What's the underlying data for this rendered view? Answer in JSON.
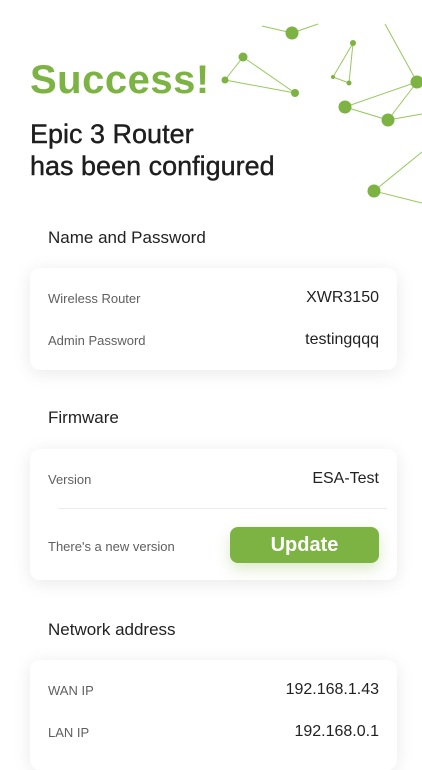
{
  "hero": {
    "title": "Success!",
    "subtitle_line1": "Epic 3 Router",
    "subtitle_line2": "has been configured"
  },
  "colors": {
    "accent": "#7cb342",
    "text": "#222222",
    "muted": "#5f5f5f"
  },
  "sections": {
    "name_password": {
      "title": "Name and Password",
      "wireless_router_label": "Wireless Router",
      "wireless_router_value": "XWR3150",
      "admin_password_label": "Admin Password",
      "admin_password_value": "testingqqq"
    },
    "firmware": {
      "title": "Firmware",
      "version_label": "Version",
      "version_value": "ESA-Test",
      "new_version_label": "There's a new version",
      "update_button": "Update"
    },
    "network": {
      "title": "Network address",
      "wan_label": "WAN IP",
      "wan_value": "192.168.1.43",
      "lan_label": "LAN IP",
      "lan_value": "192.168.0.1"
    }
  },
  "decoration": {
    "icon": "network-nodes-icon"
  }
}
